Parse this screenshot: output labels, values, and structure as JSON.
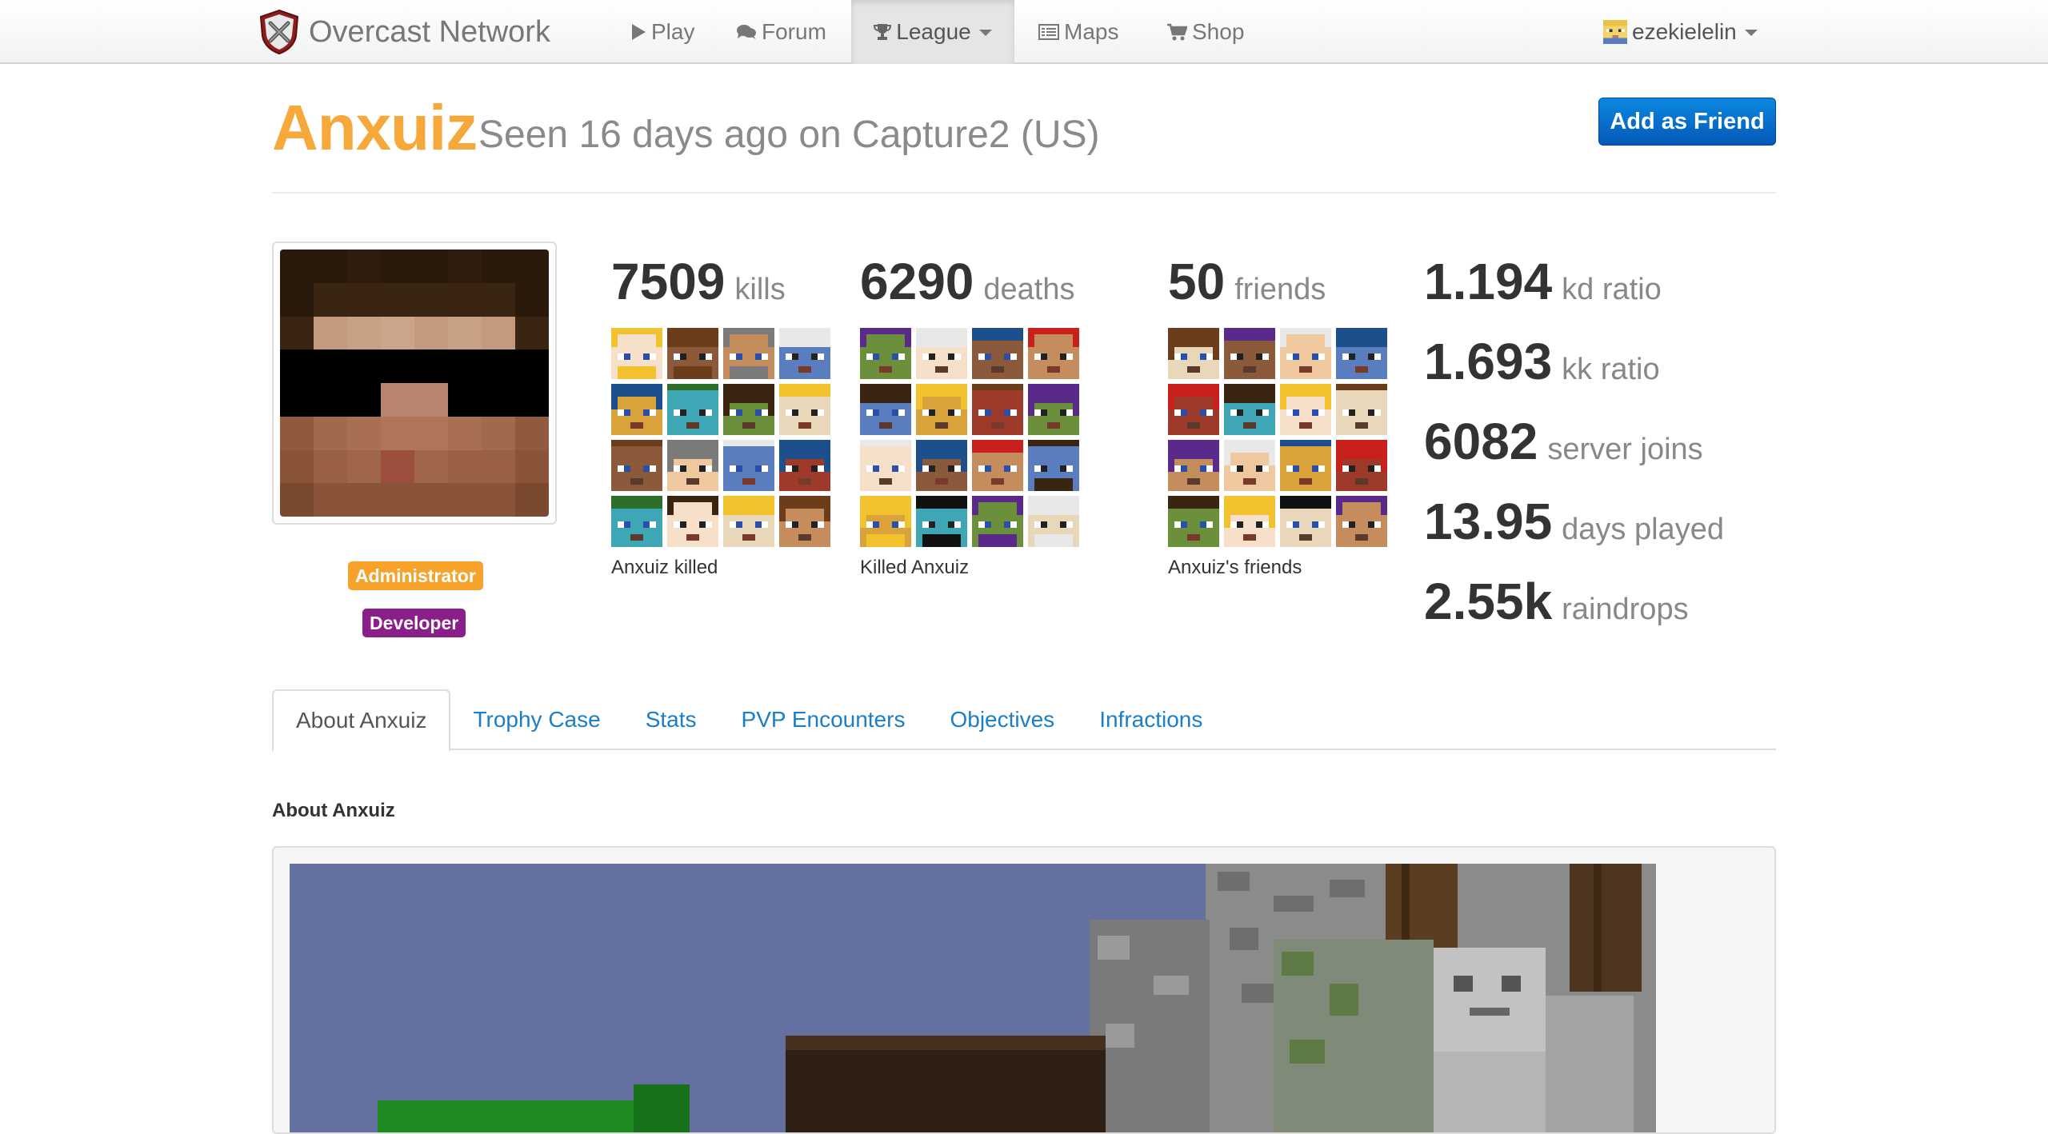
{
  "navbar": {
    "brand": "Overcast Network",
    "items": [
      {
        "label": "Play",
        "icon": "play-icon"
      },
      {
        "label": "Forum",
        "icon": "comments-icon"
      },
      {
        "label": "League",
        "icon": "trophy-icon",
        "active": true,
        "dropdown": true
      },
      {
        "label": "Maps",
        "icon": "map-list-icon"
      },
      {
        "label": "Shop",
        "icon": "cart-icon"
      }
    ],
    "user": {
      "name": "ezekielelin",
      "icon": "user-skin-icon",
      "dropdown": true
    }
  },
  "profile": {
    "name": "Anxuiz",
    "seen": "Seen 16 days ago on Capture2 (US)",
    "add_friend": "Add as Friend",
    "badges": {
      "admin": "Administrator",
      "dev": "Developer"
    },
    "badge_colors": {
      "admin": "#f7a22a",
      "dev": "#8a1f8a"
    }
  },
  "stats": {
    "kills": {
      "value": "7509",
      "label": "kills",
      "caption": "Anxuiz killed"
    },
    "deaths": {
      "value": "6290",
      "label": "deaths",
      "caption": "Killed Anxuiz"
    },
    "friends": {
      "value": "50",
      "label": "friends",
      "caption": "Anxuiz's friends"
    }
  },
  "ratios": [
    {
      "value": "1.194",
      "label": "kd ratio"
    },
    {
      "value": "1.693",
      "label": "kk ratio"
    },
    {
      "value": "6082",
      "label": "server joins"
    },
    {
      "value": "13.95",
      "label": "days played"
    },
    {
      "value": "2.55k",
      "label": "raindrops"
    }
  ],
  "tabs": [
    "About Anxuiz",
    "Trophy Case",
    "Stats",
    "PVP Encounters",
    "Objectives",
    "Infractions"
  ],
  "active_tab": 0,
  "about": {
    "title": "About Anxuiz"
  },
  "colors": {
    "accent_name": "#f7a83a",
    "link": "#1a7fc8",
    "button": "#0b6fd0"
  }
}
